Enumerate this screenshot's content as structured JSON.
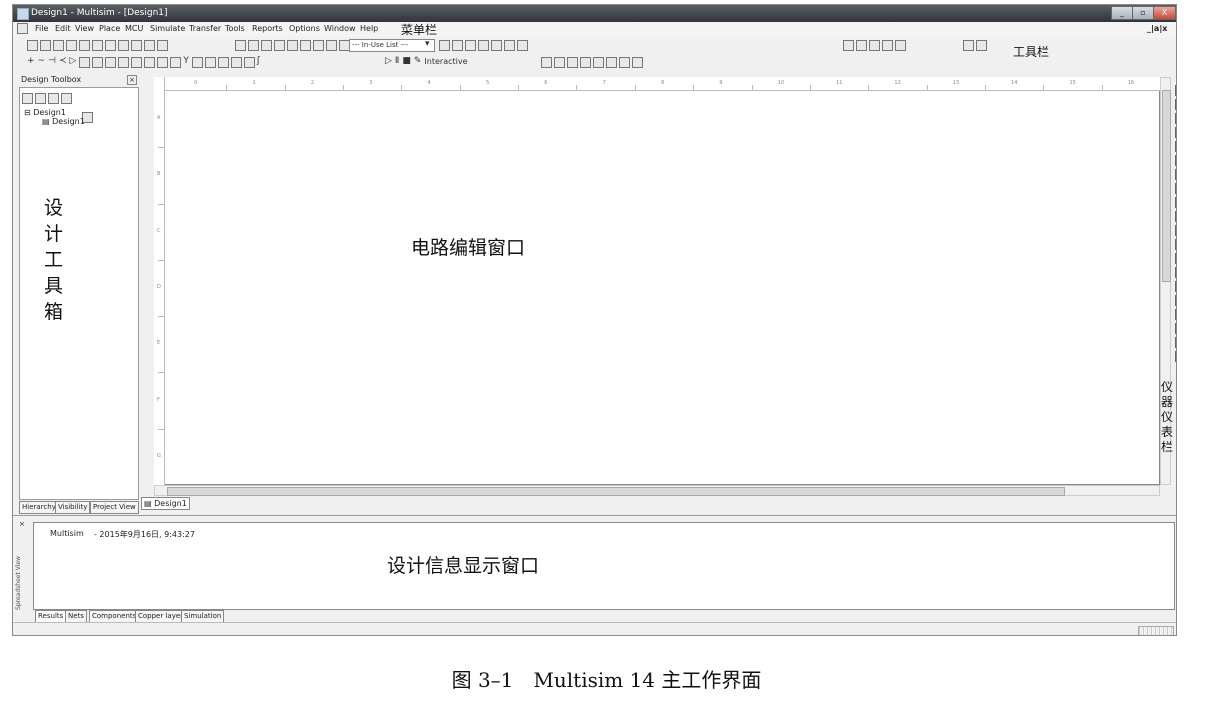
{
  "window": {
    "title": "Design1 - Multisim - [Design1]",
    "controls": [
      "_",
      "▫",
      "X"
    ],
    "mdi_controls": "_|a|x"
  },
  "menu": [
    "File",
    "Edit",
    "View",
    "Place",
    "MCU",
    "Simulate",
    "Transfer",
    "Tools",
    "Reports",
    "Options",
    "Window",
    "Help"
  ],
  "toolbar": {
    "inuse_combo": "--- In-Use List ---",
    "interactive_label": "Interactive"
  },
  "toolbox": {
    "title": "Design Toolbox",
    "close": "×",
    "tree": [
      "Design1",
      "Design1"
    ],
    "tabs": [
      "Hierarchy",
      "Visibility",
      "Project View"
    ]
  },
  "canvas": {
    "col_ticks": [
      "0",
      "1",
      "2",
      "3",
      "4",
      "5",
      "6",
      "7",
      "8",
      "9",
      "10",
      "11",
      "12",
      "13",
      "14",
      "15",
      "16"
    ],
    "row_ticks": [
      "A",
      "B",
      "C",
      "D",
      "E",
      "F",
      "G"
    ],
    "doc_tab": "Design1"
  },
  "spreadsheet": {
    "vertical_label": "Spreadsheet View",
    "log_app": "Multisim",
    "log_time": "- 2015年9月16日, 9:43:27",
    "tabs": [
      "Results",
      "Nets",
      "Components",
      "Copper layers",
      "Simulation"
    ]
  },
  "annotations": {
    "menubar": "菜单栏",
    "toolbar": "工具栏",
    "toolbox": "设计工具箱",
    "editor": "电路编辑窗口",
    "instruments": "仪器仪表栏",
    "info": "设计信息显示窗口"
  },
  "caption": "图 3–1　Multisim 14 主工作界面"
}
